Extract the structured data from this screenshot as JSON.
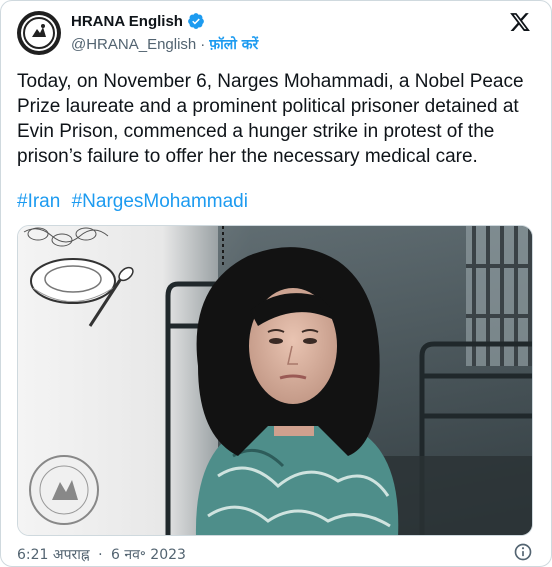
{
  "account": {
    "display_name": "HRANA English",
    "handle": "@HRANA_English",
    "separator": "·",
    "follow_label": "फ़ॉलो करें",
    "avatar_icon": "hrana-logo-icon",
    "verified_icon": "verified-badge-icon"
  },
  "tweet": {
    "text": "Today, on November 6, Narges Mohammadi, a Nobel Peace Prize laureate and a prominent political prisoner detained at Evin Prison, commenced a hunger strike in protest of the prison’s failure to offer her the necessary medical care.",
    "hashtags": [
      "#Iran",
      "#NargesMohammadi"
    ]
  },
  "media": {
    "description_icons": [
      "barbed-wire-icon",
      "empty-plate-icon",
      "spoon-icon",
      "hrana-seal-icon"
    ]
  },
  "footer": {
    "time": "6:21 अपराह्न",
    "separator": "·",
    "date": "6 नव॰ 2023"
  },
  "colors": {
    "link": "#1d9bf0",
    "secondary_text": "#536471",
    "border": "#cfd9de",
    "text": "#0f1419"
  }
}
